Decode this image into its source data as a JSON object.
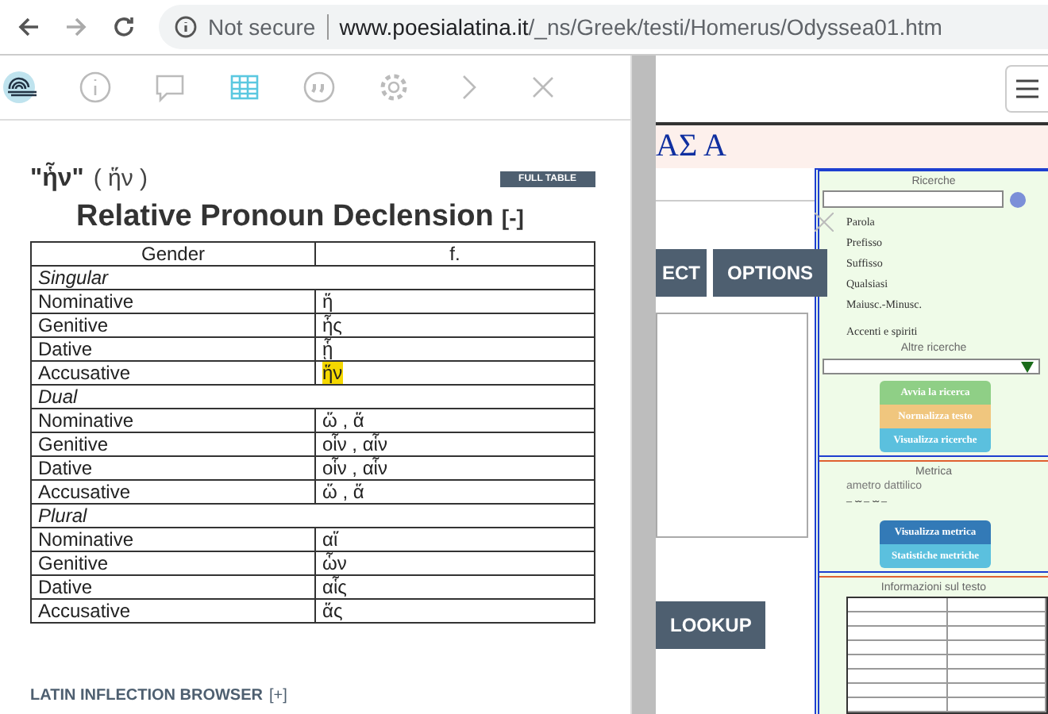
{
  "browser": {
    "security_label": "Not secure",
    "url_host": "www.poesialatina.it",
    "url_path": "/_ns/Greek/testi/Homerus/Odyssea01.htm"
  },
  "popup": {
    "toolbar": [
      {
        "kind": "logo",
        "selected": false
      },
      {
        "kind": "info",
        "selected": false
      },
      {
        "kind": "comment",
        "selected": false
      },
      {
        "kind": "table",
        "selected": true
      },
      {
        "kind": "quote",
        "selected": false
      },
      {
        "kind": "gear",
        "selected": false
      },
      {
        "kind": "next",
        "selected": false
      },
      {
        "kind": "close",
        "selected": false
      }
    ],
    "word": "\"ἧν\"",
    "lemma": "( ἥν )",
    "full_table_button": "FULL TABLE",
    "heading": "Relative Pronoun Declension",
    "heading_toggle": "[-]",
    "table": {
      "columns": [
        "Gender",
        "f."
      ],
      "rows": [
        {
          "kind": "section",
          "label": "Singular"
        },
        {
          "kind": "form",
          "case": "Nominative",
          "form": "ἥ",
          "highlighted": false
        },
        {
          "kind": "form",
          "case": "Genitive",
          "form": "ἧς",
          "highlighted": false
        },
        {
          "kind": "form",
          "case": "Dative",
          "form": "ᾗ",
          "highlighted": false
        },
        {
          "kind": "form",
          "case": "Accusative",
          "form": "ἥν",
          "highlighted": true
        },
        {
          "kind": "section",
          "label": "Dual"
        },
        {
          "kind": "form",
          "case": "Nominative",
          "form": "ὥ , ἅ",
          "highlighted": false
        },
        {
          "kind": "form",
          "case": "Genitive",
          "form": "οἷν , αἷν",
          "highlighted": false
        },
        {
          "kind": "form",
          "case": "Dative",
          "form": "οἷν , αἷν",
          "highlighted": false
        },
        {
          "kind": "form",
          "case": "Accusative",
          "form": "ὥ , ἅ",
          "highlighted": false
        },
        {
          "kind": "section",
          "label": "Plural"
        },
        {
          "kind": "form",
          "case": "Nominative",
          "form": "αἵ",
          "highlighted": false
        },
        {
          "kind": "form",
          "case": "Genitive",
          "form": "ὧν",
          "highlighted": false
        },
        {
          "kind": "form",
          "case": "Dative",
          "form": "αἷς",
          "highlighted": false
        },
        {
          "kind": "form",
          "case": "Accusative",
          "form": "ἅς",
          "highlighted": false
        }
      ]
    },
    "footer": "LATIN INFLECTION BROWSER",
    "footer_toggle": "[+]"
  },
  "page": {
    "header_title": "ΑΣ Α",
    "dialog_buttons": [
      "ECT",
      "OPTIONS"
    ],
    "lookup_button": "LOOKUP",
    "sidebar": {
      "search_title": "Ricerche",
      "search_options": [
        "Parola",
        "Prefisso",
        "Suffisso",
        "Qualsiasi",
        "Maiusc.-Minusc."
      ],
      "accents_label": "Accenti e spiriti",
      "other_title": "Altre ricerche",
      "action_buttons": [
        {
          "label": "Avvia la ricerca",
          "color": "#8fcf86"
        },
        {
          "label": "Normalizza testo",
          "color": "#f0c67e"
        },
        {
          "label": "Visualizza ricerche",
          "color": "#5bc0de"
        }
      ],
      "metrica_title": "Metrica",
      "metrica_value": "ametro dattilico",
      "metrica_scheme": "– ⏑⏑ – ⏑⏑ –",
      "metrica_buttons": [
        {
          "label": "Visualizza metrica",
          "color": "#337ab7"
        },
        {
          "label": "Statistiche metriche",
          "color": "#5bc0de"
        }
      ],
      "info_title": "Informazioni sul testo"
    }
  }
}
